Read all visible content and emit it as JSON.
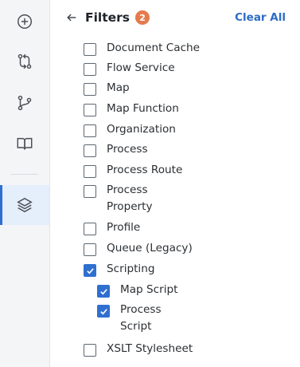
{
  "rail": {
    "items": [
      {
        "name": "add-icon"
      },
      {
        "name": "compare-icon"
      },
      {
        "name": "branch-icon"
      },
      {
        "name": "book-icon"
      },
      {
        "name": "layers-icon",
        "active": true
      }
    ]
  },
  "header": {
    "title": "Filters",
    "badge_count": "2",
    "clear_all": "Clear All"
  },
  "filters": [
    {
      "label": "Document Cache",
      "checked": false
    },
    {
      "label": "Flow Service",
      "checked": false
    },
    {
      "label": "Map",
      "checked": false
    },
    {
      "label": "Map Function",
      "checked": false
    },
    {
      "label": "Organization",
      "checked": false
    },
    {
      "label": "Process",
      "checked": false
    },
    {
      "label": "Process Route",
      "checked": false
    },
    {
      "label": "Process Property",
      "checked": false
    },
    {
      "label": "Profile",
      "checked": false
    },
    {
      "label": "Queue (Legacy)",
      "checked": false
    },
    {
      "label": "Scripting",
      "checked": true,
      "children": [
        {
          "label": "Map Script",
          "checked": true
        },
        {
          "label": "Process Script",
          "checked": true
        }
      ]
    },
    {
      "label": "XSLT Stylesheet",
      "checked": false
    }
  ],
  "colors": {
    "accent": "#2f6fd0",
    "badge": "#e57a4c",
    "link": "#2b6cc4"
  }
}
